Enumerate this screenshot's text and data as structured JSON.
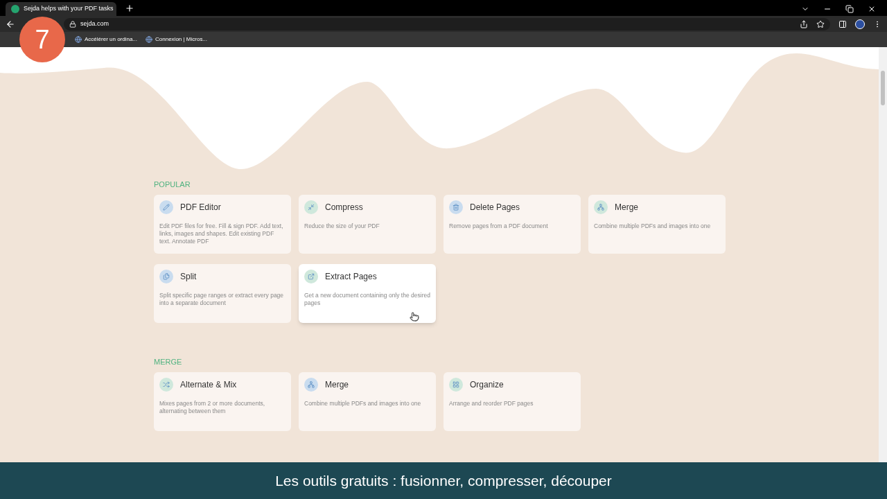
{
  "browser": {
    "tab_title": "Sejda helps with your PDF tasks",
    "url": "sejda.com",
    "bookmarks": [
      "Accélérer un ordina...",
      "Connexion | Micros..."
    ]
  },
  "step_badge": "7",
  "sections": [
    {
      "heading": "POPULAR",
      "cards": [
        {
          "title": "PDF Editor",
          "description": "Edit PDF files for free. Fill & sign PDF. Add text, links, images and shapes. Edit existing PDF text. Annotate PDF",
          "color": "#c9dcef",
          "selected": false
        },
        {
          "title": "Compress",
          "description": "Reduce the size of your PDF",
          "color": "#cfe8dc",
          "selected": false
        },
        {
          "title": "Delete Pages",
          "description": "Remove pages from a PDF document",
          "color": "#c9dcef",
          "selected": false
        },
        {
          "title": "Merge",
          "description": "Combine multiple PDFs and images into one",
          "color": "#cfe8dc",
          "selected": false
        },
        {
          "title": "Split",
          "description": "Split specific page ranges or extract every page into a separate document",
          "color": "#c9dcef",
          "selected": false
        },
        {
          "title": "Extract Pages",
          "description": "Get a new document containing only the desired pages",
          "color": "#cfe8dc",
          "selected": true
        }
      ]
    },
    {
      "heading": "MERGE",
      "cards": [
        {
          "title": "Alternate & Mix",
          "description": "Mixes pages from 2 or more documents, alternating between them",
          "color": "#cfe8dc",
          "selected": false
        },
        {
          "title": "Merge",
          "description": "Combine multiple PDFs and images into one",
          "color": "#c9dcef",
          "selected": false
        },
        {
          "title": "Organize",
          "description": "Arrange and reorder PDF pages",
          "color": "#cfe8dc",
          "selected": false
        }
      ]
    }
  ],
  "caption": "Les outils gratuits : fusionner, compresser, découper"
}
